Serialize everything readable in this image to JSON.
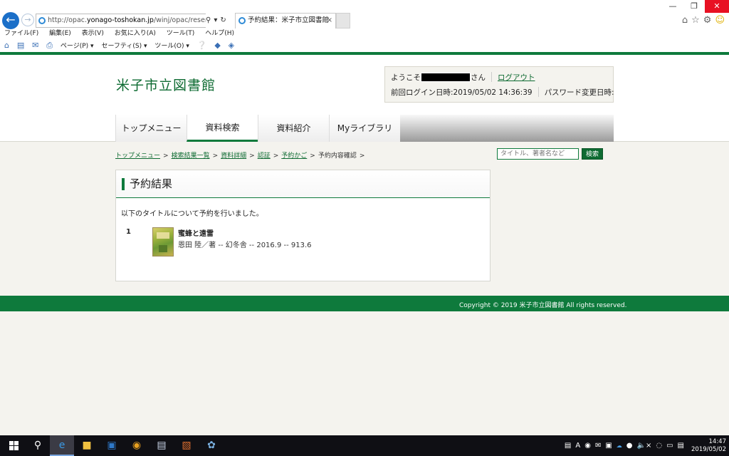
{
  "browser": {
    "address_prefix": "http://opac.",
    "address_domain": "yonago-toshokan.jp",
    "address_suffix": "/winj/opac/reserve-confirm",
    "tab_title": "予約結果：米子市立図書館",
    "menu": [
      "ファイル(F)",
      "編集(E)",
      "表示(V)",
      "お気に入り(A)",
      "ツール(T)",
      "ヘルプ(H)"
    ],
    "commands": [
      "ページ(P) ▾",
      "セーフティ(S) ▾",
      "ツール(O) ▾"
    ]
  },
  "site": {
    "title": "米子市立図書館",
    "welcome_prefix": "ようこそ",
    "welcome_suffix": "さん",
    "logout": "ログアウト",
    "last_login": "前回ログイン日時:2019/05/02 14:36:39",
    "password_changed": "パスワード変更日時:"
  },
  "nav": [
    "トップメニュー",
    "資料検索",
    "資料紹介",
    "Myライブラリ"
  ],
  "breadcrumb": {
    "links": [
      "トップメニュー",
      "検索結果一覧",
      "資料詳細",
      "認証",
      "予約かご"
    ],
    "current": "予約内容確認"
  },
  "search": {
    "placeholder": "タイトル、著者名など",
    "button": "検索"
  },
  "result": {
    "heading": "予約結果",
    "message": "以下のタイトルについて予約を行いました。",
    "items": [
      {
        "no": "1",
        "title": "蜜蜂と遠雷",
        "meta": "恩田 陸／著 -- 幻冬舎 -- 2016.9 -- 913.6"
      }
    ]
  },
  "footer": {
    "copyright": "Copyright © 2019 米子市立図書館 All rights reserved."
  },
  "taskbar": {
    "time": "14:47",
    "date": "2019/05/02"
  },
  "colors": {
    "brand_green": "#0e7a3c",
    "ie_blue": "#1b6fc8",
    "close_red": "#e81123"
  }
}
